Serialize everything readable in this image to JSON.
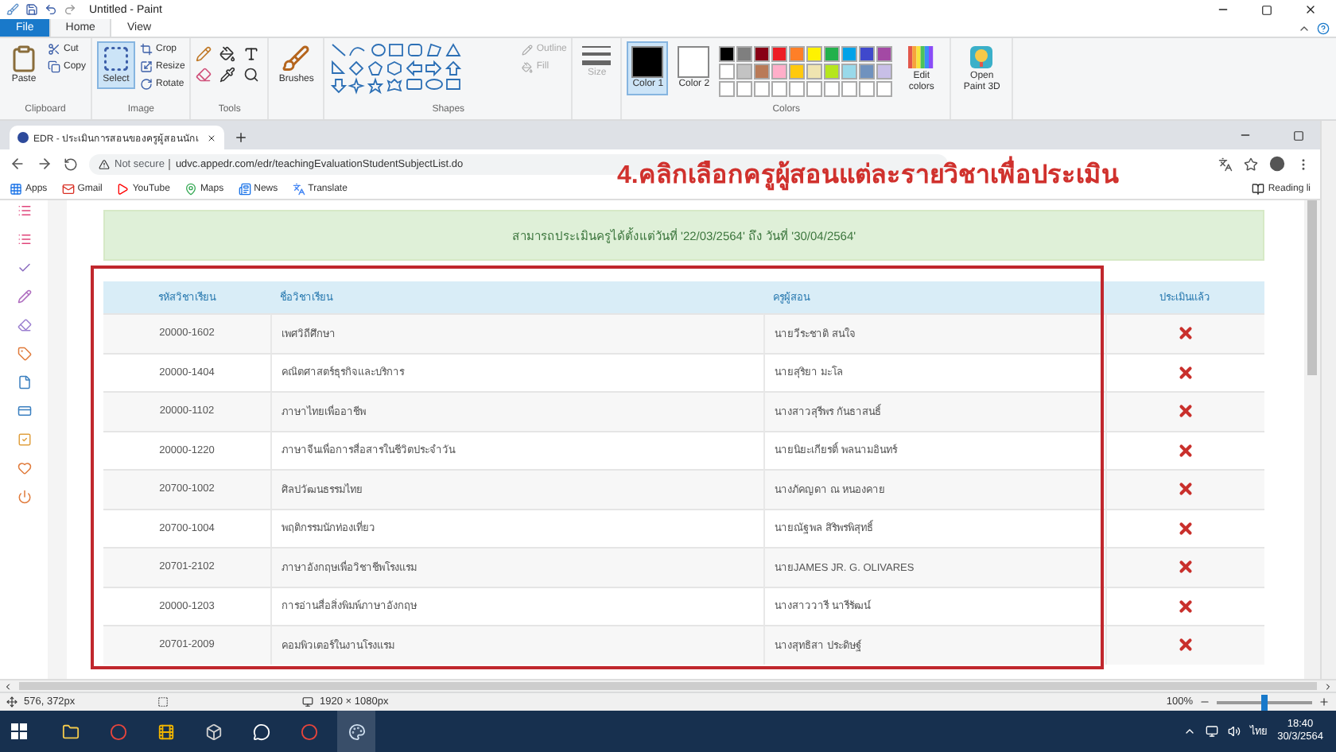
{
  "paint": {
    "title": "Untitled - Paint",
    "menu_tabs": [
      {
        "label": "File",
        "kind": "file",
        "selected": false
      },
      {
        "label": "Home",
        "kind": "tab",
        "selected": true
      },
      {
        "label": "View",
        "kind": "tab",
        "selected": false
      }
    ],
    "clipboard": {
      "label": "Clipboard",
      "paste": "Paste",
      "cut": "Cut",
      "copy": "Copy"
    },
    "image": {
      "label": "Image",
      "select": {
        "label": "Select",
        "selected": true
      },
      "crop": "Crop",
      "resize": "Resize",
      "rotate": "Rotate"
    },
    "tools": {
      "label": "Tools"
    },
    "brushes": {
      "label": "Brushes"
    },
    "shapes": {
      "label": "Shapes",
      "outline": {
        "label": "Outline",
        "disabled": true
      },
      "fill": {
        "label": "Fill",
        "disabled": true
      }
    },
    "size": {
      "label": "Size",
      "disabled": true
    },
    "color_slots": [
      {
        "label": "Color 1",
        "color": "#000000",
        "selected": true
      },
      {
        "label": "Color 2",
        "color": "#ffffff",
        "selected": false
      }
    ],
    "colors": {
      "label": "Colors",
      "edit": "Edit colors",
      "palette": [
        {
          "color": "#000000"
        },
        {
          "color": "#7f7f7f"
        },
        {
          "color": "#880015"
        },
        {
          "color": "#ed1c24"
        },
        {
          "color": "#ff7f27"
        },
        {
          "color": "#fff200"
        },
        {
          "color": "#22b14c"
        },
        {
          "color": "#00a2e8"
        },
        {
          "color": "#3f48cc"
        },
        {
          "color": "#a349a4"
        },
        {
          "color": "#ffffff"
        },
        {
          "color": "#c3c3c3"
        },
        {
          "color": "#b97a57"
        },
        {
          "color": "#ffaec9"
        },
        {
          "color": "#ffc90e"
        },
        {
          "color": "#efe4b0"
        },
        {
          "color": "#b5e61d"
        },
        {
          "color": "#99d9ea"
        },
        {
          "color": "#7092be"
        },
        {
          "color": "#c8bfe7"
        }
      ]
    },
    "paint3d": "Open Paint 3D",
    "status": {
      "cursor": "576, 372px",
      "dimensions": "1920 × 1080px",
      "zoom": "100%",
      "zoom_slider": {
        "level": 0.5
      }
    }
  },
  "browser": {
    "tab": {
      "title": "EDR - ประเมินการสอนของครูผู้สอนนักเ",
      "selected": true
    },
    "security": "Not secure",
    "url": "udvc.appedr.com/edr/teachingEvaluationStudentSubjectList.do",
    "bookmarks": [
      {
        "kind": "apps",
        "label": "Apps"
      },
      {
        "kind": "gmail",
        "label": "Gmail"
      },
      {
        "kind": "youtube",
        "label": "YouTube"
      },
      {
        "kind": "maps",
        "label": "Maps"
      },
      {
        "kind": "news",
        "label": "News"
      },
      {
        "kind": "translate",
        "label": "Translate"
      }
    ],
    "reading_list": "Reading li"
  },
  "annotation": "4.คลิกเลือกครูผู้สอนแต่ละรายวิชาเพื่อประเมิน",
  "page": {
    "sidebar_icons": [
      {
        "kind": "list"
      },
      {
        "kind": "list"
      },
      {
        "kind": "check"
      },
      {
        "kind": "pencil"
      },
      {
        "kind": "eraser"
      },
      {
        "kind": "tag"
      },
      {
        "kind": "file"
      },
      {
        "kind": "card"
      },
      {
        "kind": "checkbox"
      },
      {
        "kind": "heart"
      },
      {
        "kind": "power"
      }
    ],
    "notice": "สามารถประเมินครูได้ตั้งแต่วันที่ '22/03/2564' ถึง วันที่ '30/04/2564'",
    "columns": [
      "รหัสวิชาเรียน",
      "ชื่อวิชาเรียน",
      "ครูผู้สอน",
      "ประเมินแล้ว"
    ],
    "rows": [
      {
        "code": "20000-1602",
        "subject": "เพศวิถีศึกษา",
        "teacher": "นายวีระชาติ สนใจ",
        "evaluated": false
      },
      {
        "code": "20000-1404",
        "subject": "คณิตศาสตร์ธุรกิจและบริการ",
        "teacher": "นายสุริยา มะโล",
        "evaluated": false
      },
      {
        "code": "20000-1102",
        "subject": "ภาษาไทยเพื่ออาชีพ",
        "teacher": "นางสาวสุรีพร กันธาสนธิ์",
        "evaluated": false
      },
      {
        "code": "20000-1220",
        "subject": "ภาษาจีนเพื่อการสื่อสารในชีวิตประจำวัน",
        "teacher": "นายนิยะเกียรติ์ พลนามอินทร์",
        "evaluated": false
      },
      {
        "code": "20700-1002",
        "subject": "ศิลปวัฒนธรรมไทย",
        "teacher": "นางภัคญดา ณ หนองคาย",
        "evaluated": false
      },
      {
        "code": "20700-1004",
        "subject": "พฤติกรรมนักท่องเที่ยว",
        "teacher": "นายณัฐพล สิริพรพิสุทธิ์",
        "evaluated": false
      },
      {
        "code": "20701-2102",
        "subject": "ภาษาอังกฤษเพื่อวิชาชีพโรงแรม",
        "teacher": "นายJAMES JR. G. OLIVARES",
        "evaluated": false
      },
      {
        "code": "20000-1203",
        "subject": "การอ่านสื่อสิ่งพิมพ์ภาษาอังกฤษ",
        "teacher": "นางสาววารี นารีรัฒน์",
        "evaluated": false
      },
      {
        "code": "20701-2009",
        "subject": "คอมพิวเตอร์ในงานโรงแรม",
        "teacher": "นางสุทธิสา ประดิษฐ์",
        "evaluated": false
      }
    ]
  },
  "taskbar": {
    "apps": [
      {
        "kind": "explorer"
      },
      {
        "kind": "chrome"
      },
      {
        "kind": "media"
      },
      {
        "kind": "app"
      },
      {
        "kind": "line"
      },
      {
        "kind": "chrome"
      },
      {
        "kind": "paint"
      }
    ],
    "language": "ไทย",
    "time": "18:40",
    "date": "30/3/2564"
  }
}
